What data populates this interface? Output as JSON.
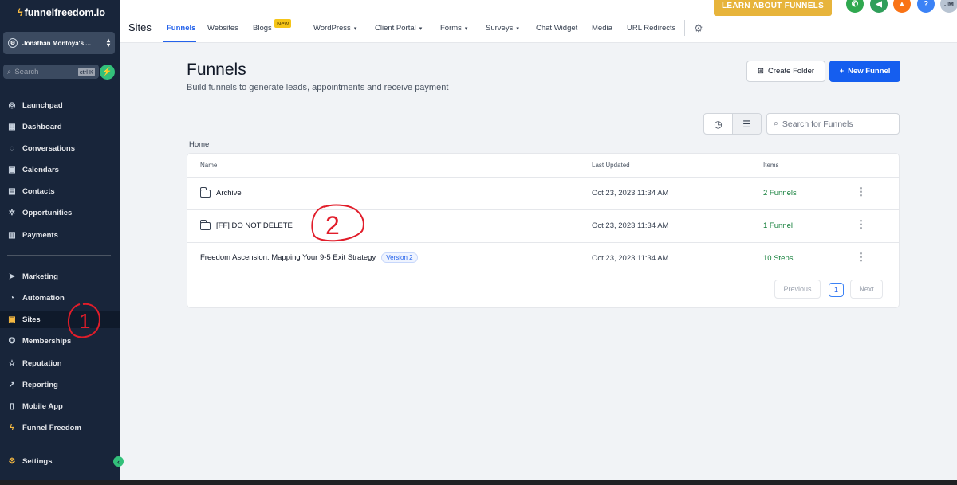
{
  "sidebar": {
    "brand": "funnelfreedom.io",
    "account_name": "Jonathan Montoya's ...",
    "search_placeholder": "Search",
    "search_shortcut": "ctrl K",
    "items_top": [
      {
        "label": "Launchpad",
        "icon": "rocket-icon"
      },
      {
        "label": "Dashboard",
        "icon": "dashboard-icon"
      },
      {
        "label": "Conversations",
        "icon": "chat-icon"
      },
      {
        "label": "Calendars",
        "icon": "calendar-icon"
      },
      {
        "label": "Contacts",
        "icon": "contacts-icon"
      },
      {
        "label": "Opportunities",
        "icon": "opportunities-icon"
      },
      {
        "label": "Payments",
        "icon": "payments-icon"
      }
    ],
    "items_bottom": [
      {
        "label": "Marketing",
        "icon": "send-icon"
      },
      {
        "label": "Automation",
        "icon": "automation-icon"
      },
      {
        "label": "Sites",
        "icon": "sites-icon"
      },
      {
        "label": "Memberships",
        "icon": "award-icon"
      },
      {
        "label": "Reputation",
        "icon": "star-icon"
      },
      {
        "label": "Reporting",
        "icon": "chart-icon"
      },
      {
        "label": "Mobile App",
        "icon": "phone-icon"
      },
      {
        "label": "Funnel Freedom",
        "icon": "bolt-icon"
      }
    ],
    "settings_label": "Settings",
    "active_item": "Sites"
  },
  "topbar": {
    "section_title": "Sites",
    "tabs": [
      "Funnels",
      "Websites",
      "Blogs",
      "WordPress",
      "Client Portal",
      "Forms",
      "Surveys",
      "Chat Widget",
      "Media",
      "URL Redirects"
    ],
    "active_tab": "Funnels",
    "new_badge": "New",
    "learn_button": "LEARN ABOUT FUNNELS",
    "avatar_initials": "JM",
    "help_label": "?"
  },
  "main": {
    "title": "Funnels",
    "subtitle": "Build funnels to generate leads, appointments and receive payment",
    "create_folder_label": "Create Folder",
    "new_funnel_label": "New Funnel",
    "search_placeholder": "Search for Funnels",
    "breadcrumb": "Home",
    "columns": [
      "Name",
      "Last Updated",
      "Items"
    ],
    "rows": [
      {
        "name": "Archive",
        "type": "folder",
        "updated": "Oct 23, 2023 11:34 AM",
        "items": "2 Funnels"
      },
      {
        "name": "[FF] DO NOT DELETE",
        "type": "folder",
        "updated": "Oct 23, 2023 11:34 AM",
        "items": "1 Funnel"
      },
      {
        "name": "Freedom Ascension: Mapping Your 9-5 Exit Strategy",
        "type": "funnel",
        "version": "Version 2",
        "updated": "Oct 23, 2023 11:34 AM",
        "items": "10 Steps"
      }
    ],
    "pagination": {
      "previous": "Previous",
      "current": "1",
      "next": "Next"
    }
  },
  "annotations": [
    "1",
    "2"
  ],
  "colors": {
    "sidebar_bg": "#18253a",
    "accent": "#155eef",
    "learn_button": "#e7b43b",
    "items_green": "#16803c"
  }
}
